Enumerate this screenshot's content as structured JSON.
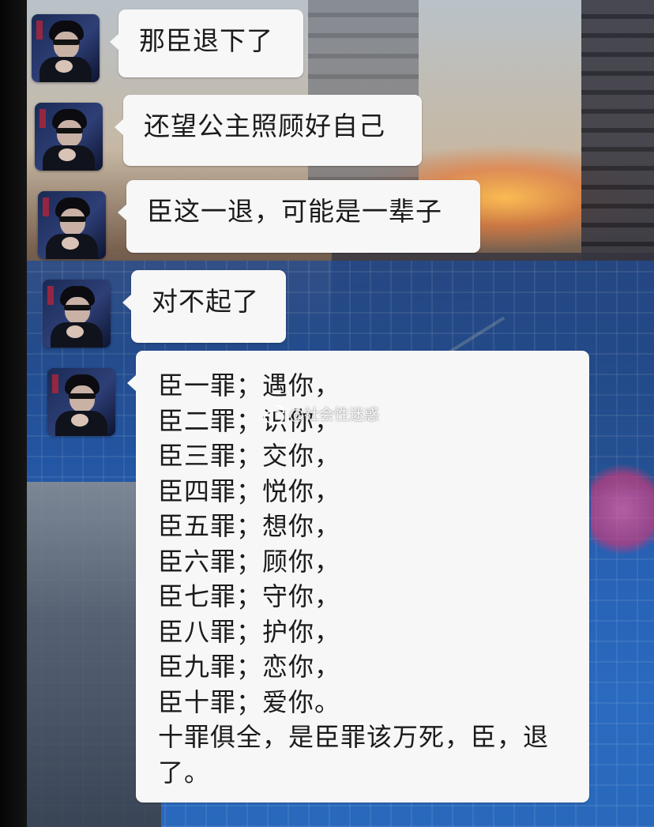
{
  "chat": {
    "messages": [
      {
        "text": "那臣退下了"
      },
      {
        "text": "还望公主照顾好自己"
      },
      {
        "text": "臣这一退，可能是一辈子"
      },
      {
        "text": "对不起了"
      },
      {
        "lines": [
          "臣一罪；遇你，",
          "臣二罪；识你，",
          "臣三罪；交你，",
          "臣四罪；悦你，",
          "臣五罪；想你，",
          "臣六罪；顾你，",
          "臣七罪；守你，",
          "臣八罪；护你，",
          "臣九罪；恋你，",
          "臣十罪；爱你。",
          "十罪俱全，是臣罪该万死，臣，退",
          "了。"
        ]
      }
    ]
  },
  "watermark": {
    "text": "@社会性迷惑",
    "icon": "weibo-icon"
  },
  "colors": {
    "bubble": "#f7f7f7",
    "text": "#1b1b1b"
  }
}
